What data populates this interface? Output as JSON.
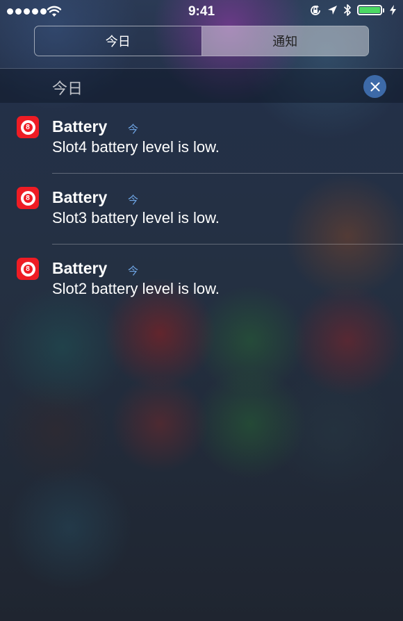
{
  "status_bar": {
    "time": "9:41",
    "signal_bars": 5,
    "battery_color": "#4cd964",
    "icons": [
      "wifi-icon",
      "orientation-lock-icon",
      "location-icon",
      "bluetooth-icon",
      "battery-icon",
      "charging-bolt-icon"
    ]
  },
  "segmented_control": {
    "today_label": "今日",
    "notifications_label": "通知",
    "selected": "notifications"
  },
  "section": {
    "title": "今日",
    "clear_icon": "close-icon",
    "clear_color": "#3d6aa8"
  },
  "notifications": [
    {
      "app": "Battery",
      "time": "今",
      "message": "Slot4 battery level is low."
    },
    {
      "app": "Battery",
      "time": "今",
      "message": "Slot3 battery level is low."
    },
    {
      "app": "Battery",
      "time": "今",
      "message": "Slot2 battery level is low."
    }
  ],
  "colors": {
    "app_icon": "#ee1c24",
    "time_label": "#6fa6e6"
  }
}
